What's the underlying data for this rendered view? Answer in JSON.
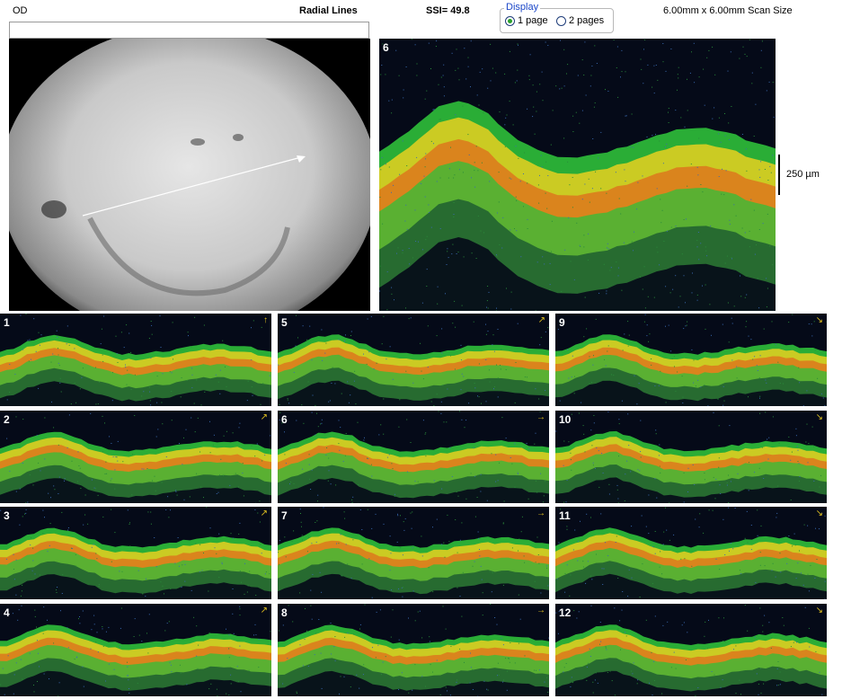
{
  "header": {
    "eye": "OD",
    "scan_pattern": "Radial Lines",
    "ssi": "SSI= 49.8",
    "scan_size": "6.00mm x 6.00mm Scan Size"
  },
  "display": {
    "legend": "Display",
    "options": [
      {
        "label": "1 page",
        "selected": true
      },
      {
        "label": "2 pages",
        "selected": false
      }
    ]
  },
  "main_scan": {
    "number": "6",
    "scale_label": "250 µm"
  },
  "thumbnails": [
    {
      "number": "1",
      "arrow": "↑"
    },
    {
      "number": "2",
      "arrow": "↗"
    },
    {
      "number": "3",
      "arrow": "↗"
    },
    {
      "number": "4",
      "arrow": "↗"
    },
    {
      "number": "5",
      "arrow": "↗"
    },
    {
      "number": "6",
      "arrow": "→"
    },
    {
      "number": "7",
      "arrow": "→"
    },
    {
      "number": "8",
      "arrow": "→"
    },
    {
      "number": "9",
      "arrow": "↘"
    },
    {
      "number": "10",
      "arrow": "↘"
    },
    {
      "number": "11",
      "arrow": "↘"
    },
    {
      "number": "12",
      "arrow": "↘"
    }
  ],
  "colors": {
    "scan_bg": "#050a18",
    "retina_green": "#2fbf3a",
    "retina_yellow": "#e8d020",
    "retina_red": "#e84a1a",
    "radio_selected": "#2aa02a",
    "legend_blue": "#1a46c8"
  }
}
